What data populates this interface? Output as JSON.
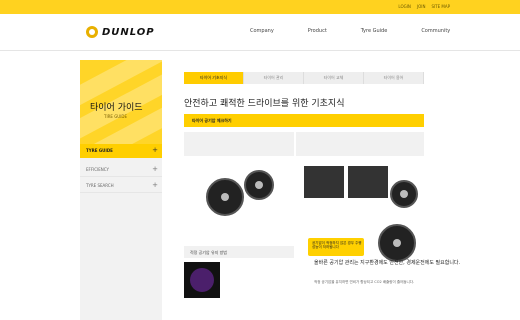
{
  "top_links": [
    "LOGIN",
    "JOIN",
    "SITE MAP"
  ],
  "brand": {
    "name": "DUNLOP"
  },
  "nav": [
    "Company",
    "Product",
    "Tyre Guide",
    "Community"
  ],
  "hero": {
    "title": "타이어 가이드",
    "subtitle": "TIRE GUIDE"
  },
  "sidebar": {
    "active": "TYRE GUIDE",
    "items": [
      "EFFICIENCY",
      "TYRE SEARCH"
    ]
  },
  "tabs": [
    "타이어 기초지식",
    "타이어 관리",
    "타이어 교체",
    "타이어 용어"
  ],
  "page": {
    "heading": "안전하고 쾌적한 드라이브를 위한 기초지식",
    "section_bar": "타이어 공기압 체크하기"
  },
  "thumb_label": "적정 공기압 유지 방법",
  "callout": {
    "text": "공기압이 적정하지 않은 경우 주행 성능이 저하됩니다"
  },
  "bottom": {
    "heading": "올바른 공기압 관리는 지구환경에도 안전한, 경제운전에도 필요합니다.",
    "text": "적정 공기압을 유지하면 연비가 향상되고 CO2 배출량이 줄어듭니다."
  },
  "colors": {
    "accent": "#ffd21f",
    "panel": "#f2f2f2"
  }
}
